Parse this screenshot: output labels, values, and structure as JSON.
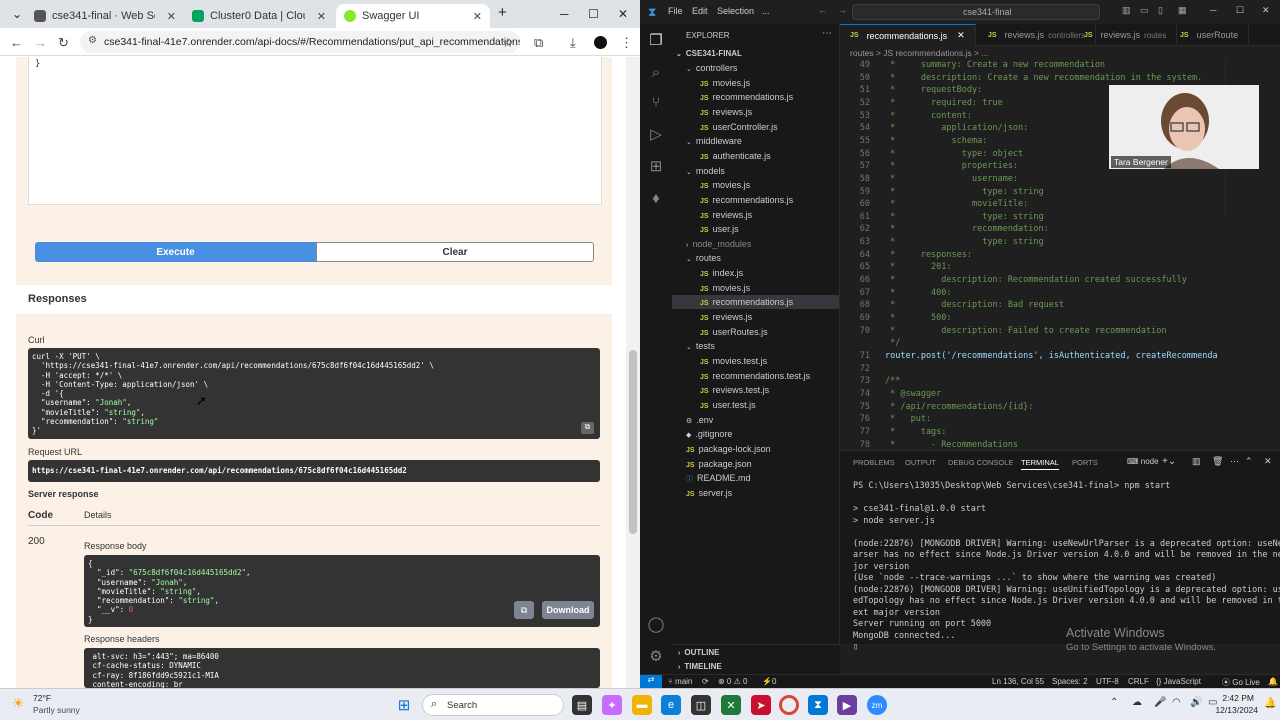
{
  "browser": {
    "tabs": [
      {
        "title": "cse341-final · Web Service · R",
        "favicon_color": "#555555"
      },
      {
        "title": "Cluster0 Data | Cloud: Mongo",
        "favicon_color": "#00a35c"
      },
      {
        "title": "Swagger UI",
        "favicon_color": "#85ea2d"
      }
    ],
    "url": "cse341-final-41e7.onrender.com/api-docs/#/Recommendations/put_api_recommendations_..."
  },
  "swagger": {
    "textarea_value": "}",
    "execute_label": "Execute",
    "clear_label": "Clear",
    "responses_title": "Responses",
    "curl_label": "Curl",
    "curl_lines": [
      "curl -X 'PUT' \\",
      "  'https://cse341-final-41e7.onrender.com/api/recommendations/675c8df6f04c16d445165dd2' \\",
      "  -H 'accept: */*' \\",
      "  -H 'Content-Type: application/json' \\",
      "  -d '{",
      "  \"username\": \"Jonah\",",
      "  \"movieTitle\": \"string\",",
      "  \"recommendation\": \"string\"",
      "}'"
    ],
    "request_url_label": "Request URL",
    "request_url": "https://cse341-final-41e7.onrender.com/api/recommendations/675c8df6f04c16d445165dd2",
    "server_response_label": "Server response",
    "code_header": "Code",
    "details_header": "Details",
    "status_code": "200",
    "response_body_label": "Response body",
    "response_body_lines": [
      "{",
      "  \"_id\": \"675c8df6f04c16d445165dd2\",",
      "  \"username\": \"Jonah\",",
      "  \"movieTitle\": \"string\",",
      "  \"recommendation\": \"string\",",
      "  \"__v\": 0",
      "}"
    ],
    "download_label": "Download",
    "response_headers_label": "Response headers",
    "response_headers_lines": [
      " alt-svc: h3=\":443\"; ma=86400",
      " cf-cache-status: DYNAMIC",
      " cf-ray: 8f186fdd9c5921c1-MIA",
      " content-encoding: br"
    ]
  },
  "vscode": {
    "menu": [
      "File",
      "Edit",
      "Selection",
      "..."
    ],
    "search_text": "cse341-final",
    "explorer_title": "EXPLORER",
    "project": "CSE341-FINAL",
    "tree": [
      {
        "name": "controllers",
        "type": "folder",
        "indent": 1
      },
      {
        "name": "movies.js",
        "type": "js",
        "indent": 2
      },
      {
        "name": "recommendations.js",
        "type": "js",
        "indent": 2
      },
      {
        "name": "reviews.js",
        "type": "js",
        "indent": 2
      },
      {
        "name": "userController.js",
        "type": "js",
        "indent": 2
      },
      {
        "name": "middleware",
        "type": "folder",
        "indent": 1
      },
      {
        "name": "authenticate.js",
        "type": "js",
        "indent": 2
      },
      {
        "name": "models",
        "type": "folder",
        "indent": 1
      },
      {
        "name": "movies.js",
        "type": "js",
        "indent": 2
      },
      {
        "name": "recommendations.js",
        "type": "js",
        "indent": 2
      },
      {
        "name": "reviews.js",
        "type": "js",
        "indent": 2
      },
      {
        "name": "user.js",
        "type": "js",
        "indent": 2
      },
      {
        "name": "node_modules",
        "type": "folder-closed",
        "indent": 1
      },
      {
        "name": "routes",
        "type": "folder",
        "indent": 1
      },
      {
        "name": "index.js",
        "type": "js",
        "indent": 2
      },
      {
        "name": "movies.js",
        "type": "js",
        "indent": 2
      },
      {
        "name": "recommendations.js",
        "type": "js-selected",
        "indent": 2
      },
      {
        "name": "reviews.js",
        "type": "js",
        "indent": 2
      },
      {
        "name": "userRoutes.js",
        "type": "js",
        "indent": 2
      },
      {
        "name": "tests",
        "type": "folder",
        "indent": 1
      },
      {
        "name": "movies.test.js",
        "type": "js",
        "indent": 2
      },
      {
        "name": "recommendations.test.js",
        "type": "js",
        "indent": 2
      },
      {
        "name": "reviews.test.js",
        "type": "js",
        "indent": 2
      },
      {
        "name": "user.test.js",
        "type": "js",
        "indent": 2
      },
      {
        "name": ".env",
        "type": "env",
        "indent": 1
      },
      {
        "name": ".gitignore",
        "type": "git",
        "indent": 1
      },
      {
        "name": "package-lock.json",
        "type": "json",
        "indent": 1
      },
      {
        "name": "package.json",
        "type": "json",
        "indent": 1
      },
      {
        "name": "README.md",
        "type": "md",
        "indent": 1
      },
      {
        "name": "server.js",
        "type": "js",
        "indent": 1
      }
    ],
    "editor_tabs": [
      {
        "name": "recommendations.js",
        "hint": "",
        "active": true
      },
      {
        "name": "reviews.js",
        "hint": "controllers",
        "active": false
      },
      {
        "name": "reviews.js",
        "hint": "routes",
        "active": false
      },
      {
        "name": "userRoute",
        "hint": "",
        "active": false
      }
    ],
    "breadcrumb": "routes > JS recommendations.js > ...",
    "code_lines": [
      {
        "n": "49",
        "t": " *     summary: Create a new recommendation",
        "c": "#6a9955"
      },
      {
        "n": "50",
        "t": " *     description: Create a new recommendation in the system.",
        "c": "#6a9955"
      },
      {
        "n": "51",
        "t": " *     requestBody:",
        "c": "#6a9955"
      },
      {
        "n": "52",
        "t": " *       required: true",
        "c": "#6a9955"
      },
      {
        "n": "53",
        "t": " *       content:",
        "c": "#6a9955"
      },
      {
        "n": "54",
        "t": " *         application/json:",
        "c": "#6a9955"
      },
      {
        "n": "55",
        "t": " *           schema:",
        "c": "#6a9955"
      },
      {
        "n": "56",
        "t": " *             type: object",
        "c": "#6a9955"
      },
      {
        "n": "57",
        "t": " *             properties:",
        "c": "#6a9955"
      },
      {
        "n": "58",
        "t": " *               username:",
        "c": "#6a9955"
      },
      {
        "n": "59",
        "t": " *                 type: string",
        "c": "#6a9955"
      },
      {
        "n": "60",
        "t": " *               movieTitle:",
        "c": "#6a9955"
      },
      {
        "n": "61",
        "t": " *                 type: string",
        "c": "#6a9955"
      },
      {
        "n": "62",
        "t": " *               recommendation:",
        "c": "#6a9955"
      },
      {
        "n": "63",
        "t": " *                 type: string",
        "c": "#6a9955"
      },
      {
        "n": "64",
        "t": " *     responses:",
        "c": "#6a9955"
      },
      {
        "n": "65",
        "t": " *       201:",
        "c": "#6a9955"
      },
      {
        "n": "66",
        "t": " *         description: Recommendation created successfully",
        "c": "#6a9955"
      },
      {
        "n": "67",
        "t": " *       400:",
        "c": "#6a9955"
      },
      {
        "n": "68",
        "t": " *         description: Bad request",
        "c": "#6a9955"
      },
      {
        "n": "69",
        "t": " *       500:",
        "c": "#6a9955"
      },
      {
        "n": "70",
        "t": " *         description: Failed to create recommendation",
        "c": "#6a9955"
      },
      {
        "n": "",
        "t": " */",
        "c": "#6a9955"
      },
      {
        "n": "71",
        "t": "router.post('/recommendations', isAuthenticated, createRecommenda",
        "c": "#9cdcfe"
      },
      {
        "n": "72",
        "t": "",
        "c": "#ccc"
      },
      {
        "n": "73",
        "t": "/**",
        "c": "#6a9955"
      },
      {
        "n": "74",
        "t": " * @swagger",
        "c": "#6a9955"
      },
      {
        "n": "75",
        "t": " * /api/recommendations/{id}:",
        "c": "#6a9955"
      },
      {
        "n": "76",
        "t": " *   put:",
        "c": "#6a9955"
      },
      {
        "n": "77",
        "t": " *     tags:",
        "c": "#6a9955"
      },
      {
        "n": "78",
        "t": " *       - Recommendations",
        "c": "#6a9955"
      }
    ],
    "panel_tabs": [
      "PROBLEMS",
      "OUTPUT",
      "DEBUG CONSOLE",
      "TERMINAL",
      "PORTS"
    ],
    "terminal_shell": "node",
    "terminal_lines": [
      "PS C:\\Users\\13035\\Desktop\\Web Services\\cse341-final> npm start",
      "",
      "> cse341-final@1.0.0 start",
      "> node server.js",
      "",
      "(node:22876) [MONGODB DRIVER] Warning: useNewUrlParser is a deprecated option: useNewUrlP",
      "arser has no effect since Node.js Driver version 4.0.0 and will be removed in the next ma",
      "jor version",
      "(Use `node --trace-warnings ...` to show where the warning was created)",
      "(node:22876) [MONGODB DRIVER] Warning: useUnifiedTopology is a deprecated option: useUnifi",
      "edTopology has no effect since Node.js Driver version 4.0.0 and will be removed in the n",
      "ext major version",
      "Server running on port 5000",
      "MongoDB connected...",
      "▯"
    ],
    "outline_label": "OUTLINE",
    "timeline_label": "TIMELINE",
    "status": {
      "branch": "main",
      "errors": "⊗ 0 ⚠ 0",
      "ports": "⚡0",
      "position": "Ln 136, Col 55",
      "spaces": "Spaces: 2",
      "encoding": "UTF-8",
      "eol": "CRLF",
      "language": "JavaScript",
      "golive": "Go Live"
    }
  },
  "webcam_name": "Tara Bergener",
  "activate": {
    "title": "Activate Windows",
    "subtitle": "Go to Settings to activate Windows."
  },
  "taskbar": {
    "weather_temp": "72°F",
    "weather_desc": "Partly sunny",
    "search_label": "Search",
    "time": "2:42 PM",
    "date": "12/13/2024"
  }
}
